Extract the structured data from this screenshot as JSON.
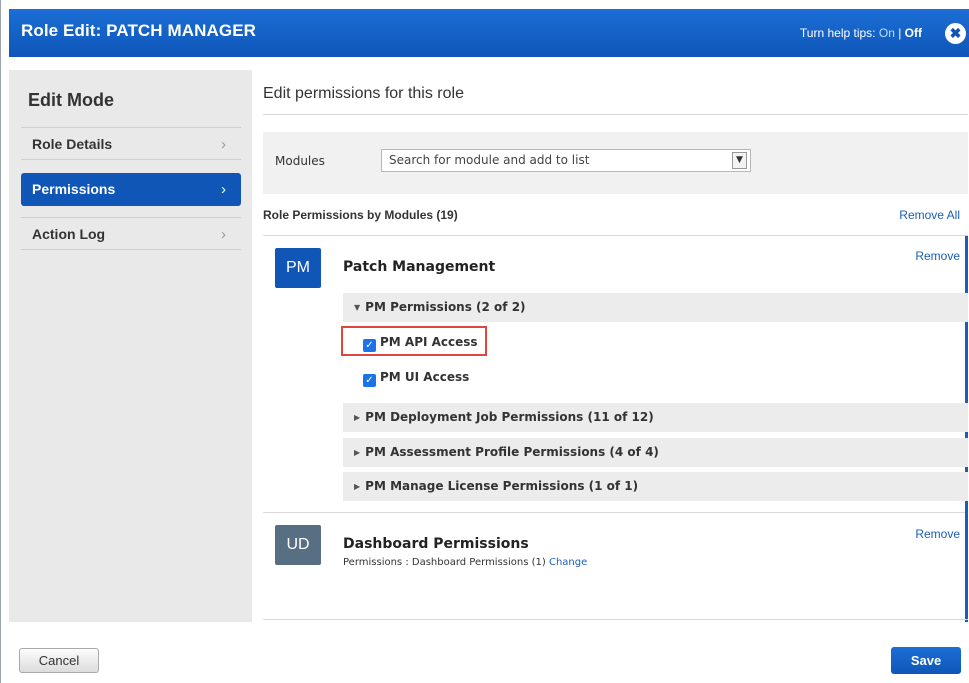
{
  "dialog": {
    "title": "Role Edit: PATCH MANAGER",
    "help_prefix": "Turn help tips: ",
    "help_on": "On",
    "help_sep": " | ",
    "help_off": "Off",
    "close_glyph": "✖"
  },
  "sidebar": {
    "mode_title": "Edit Mode",
    "items": [
      {
        "label": "Role Details",
        "active": false
      },
      {
        "label": "Permissions",
        "active": true
      },
      {
        "label": "Action Log",
        "active": false
      }
    ],
    "chevron": "›"
  },
  "main": {
    "heading": "Edit permissions for this role",
    "modules_label": "Modules",
    "modules_select_value": "Search for module and add to list",
    "modules_select_arrow": "▼",
    "section_title": "Role Permissions by Modules (19)",
    "remove_all": "Remove All",
    "modules": [
      {
        "abbr": "PM",
        "name": "Patch Management",
        "remove": "Remove",
        "groups": [
          {
            "label": "PM Permissions (2 of 2)",
            "expanded": true,
            "tri": "▼",
            "items": [
              {
                "label": "PM API Access",
                "checked": true,
                "highlighted": true
              },
              {
                "label": "PM UI Access",
                "checked": true
              }
            ]
          },
          {
            "label": "PM Deployment Job Permissions (11 of 12)",
            "expanded": false,
            "tri": "▶"
          },
          {
            "label": "PM Assessment Profile Permissions (4 of 4)",
            "expanded": false,
            "tri": "▶"
          },
          {
            "label": "PM Manage License Permissions (1 of 1)",
            "expanded": false,
            "tri": "▶"
          }
        ]
      },
      {
        "abbr": "UD",
        "name": "Dashboard Permissions",
        "remove": "Remove",
        "sub_prefix": "Permissions : Dashboard Permissions (1) ",
        "sub_link": "Change"
      }
    ],
    "check_glyph": "✓"
  },
  "footer": {
    "cancel_label": "Cancel",
    "save_label": "Save"
  },
  "colors": {
    "primary": "#0f56b7",
    "link": "#1a5fb4",
    "highlight": "#e0453e",
    "ud_avatar": "#586f83"
  }
}
